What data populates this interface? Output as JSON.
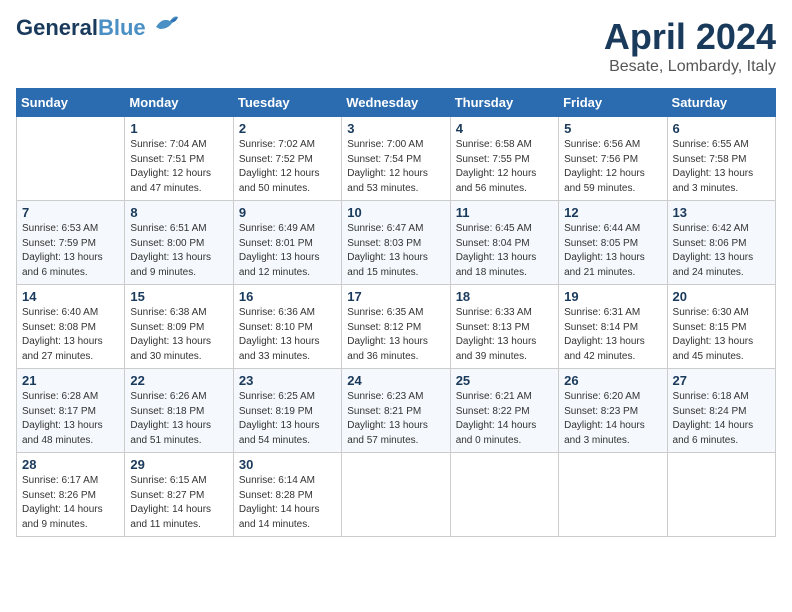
{
  "header": {
    "logo_line1": "General",
    "logo_line2": "Blue",
    "month": "April 2024",
    "location": "Besate, Lombardy, Italy"
  },
  "weekdays": [
    "Sunday",
    "Monday",
    "Tuesday",
    "Wednesday",
    "Thursday",
    "Friday",
    "Saturday"
  ],
  "weeks": [
    [
      {
        "day": "",
        "info": ""
      },
      {
        "day": "1",
        "info": "Sunrise: 7:04 AM\nSunset: 7:51 PM\nDaylight: 12 hours\nand 47 minutes."
      },
      {
        "day": "2",
        "info": "Sunrise: 7:02 AM\nSunset: 7:52 PM\nDaylight: 12 hours\nand 50 minutes."
      },
      {
        "day": "3",
        "info": "Sunrise: 7:00 AM\nSunset: 7:54 PM\nDaylight: 12 hours\nand 53 minutes."
      },
      {
        "day": "4",
        "info": "Sunrise: 6:58 AM\nSunset: 7:55 PM\nDaylight: 12 hours\nand 56 minutes."
      },
      {
        "day": "5",
        "info": "Sunrise: 6:56 AM\nSunset: 7:56 PM\nDaylight: 12 hours\nand 59 minutes."
      },
      {
        "day": "6",
        "info": "Sunrise: 6:55 AM\nSunset: 7:58 PM\nDaylight: 13 hours\nand 3 minutes."
      }
    ],
    [
      {
        "day": "7",
        "info": "Sunrise: 6:53 AM\nSunset: 7:59 PM\nDaylight: 13 hours\nand 6 minutes."
      },
      {
        "day": "8",
        "info": "Sunrise: 6:51 AM\nSunset: 8:00 PM\nDaylight: 13 hours\nand 9 minutes."
      },
      {
        "day": "9",
        "info": "Sunrise: 6:49 AM\nSunset: 8:01 PM\nDaylight: 13 hours\nand 12 minutes."
      },
      {
        "day": "10",
        "info": "Sunrise: 6:47 AM\nSunset: 8:03 PM\nDaylight: 13 hours\nand 15 minutes."
      },
      {
        "day": "11",
        "info": "Sunrise: 6:45 AM\nSunset: 8:04 PM\nDaylight: 13 hours\nand 18 minutes."
      },
      {
        "day": "12",
        "info": "Sunrise: 6:44 AM\nSunset: 8:05 PM\nDaylight: 13 hours\nand 21 minutes."
      },
      {
        "day": "13",
        "info": "Sunrise: 6:42 AM\nSunset: 8:06 PM\nDaylight: 13 hours\nand 24 minutes."
      }
    ],
    [
      {
        "day": "14",
        "info": "Sunrise: 6:40 AM\nSunset: 8:08 PM\nDaylight: 13 hours\nand 27 minutes."
      },
      {
        "day": "15",
        "info": "Sunrise: 6:38 AM\nSunset: 8:09 PM\nDaylight: 13 hours\nand 30 minutes."
      },
      {
        "day": "16",
        "info": "Sunrise: 6:36 AM\nSunset: 8:10 PM\nDaylight: 13 hours\nand 33 minutes."
      },
      {
        "day": "17",
        "info": "Sunrise: 6:35 AM\nSunset: 8:12 PM\nDaylight: 13 hours\nand 36 minutes."
      },
      {
        "day": "18",
        "info": "Sunrise: 6:33 AM\nSunset: 8:13 PM\nDaylight: 13 hours\nand 39 minutes."
      },
      {
        "day": "19",
        "info": "Sunrise: 6:31 AM\nSunset: 8:14 PM\nDaylight: 13 hours\nand 42 minutes."
      },
      {
        "day": "20",
        "info": "Sunrise: 6:30 AM\nSunset: 8:15 PM\nDaylight: 13 hours\nand 45 minutes."
      }
    ],
    [
      {
        "day": "21",
        "info": "Sunrise: 6:28 AM\nSunset: 8:17 PM\nDaylight: 13 hours\nand 48 minutes."
      },
      {
        "day": "22",
        "info": "Sunrise: 6:26 AM\nSunset: 8:18 PM\nDaylight: 13 hours\nand 51 minutes."
      },
      {
        "day": "23",
        "info": "Sunrise: 6:25 AM\nSunset: 8:19 PM\nDaylight: 13 hours\nand 54 minutes."
      },
      {
        "day": "24",
        "info": "Sunrise: 6:23 AM\nSunset: 8:21 PM\nDaylight: 13 hours\nand 57 minutes."
      },
      {
        "day": "25",
        "info": "Sunrise: 6:21 AM\nSunset: 8:22 PM\nDaylight: 14 hours\nand 0 minutes."
      },
      {
        "day": "26",
        "info": "Sunrise: 6:20 AM\nSunset: 8:23 PM\nDaylight: 14 hours\nand 3 minutes."
      },
      {
        "day": "27",
        "info": "Sunrise: 6:18 AM\nSunset: 8:24 PM\nDaylight: 14 hours\nand 6 minutes."
      }
    ],
    [
      {
        "day": "28",
        "info": "Sunrise: 6:17 AM\nSunset: 8:26 PM\nDaylight: 14 hours\nand 9 minutes."
      },
      {
        "day": "29",
        "info": "Sunrise: 6:15 AM\nSunset: 8:27 PM\nDaylight: 14 hours\nand 11 minutes."
      },
      {
        "day": "30",
        "info": "Sunrise: 6:14 AM\nSunset: 8:28 PM\nDaylight: 14 hours\nand 14 minutes."
      },
      {
        "day": "",
        "info": ""
      },
      {
        "day": "",
        "info": ""
      },
      {
        "day": "",
        "info": ""
      },
      {
        "day": "",
        "info": ""
      }
    ]
  ]
}
